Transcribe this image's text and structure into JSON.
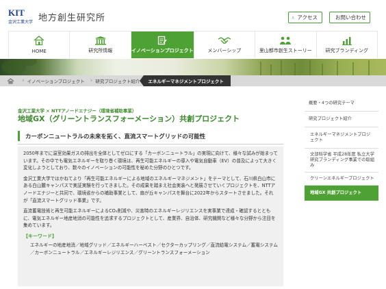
{
  "header": {
    "logo_text": "KIT",
    "logo_sub": "金沢工業大学",
    "site_title": "地方創生研究所",
    "access_label": "アクセス",
    "contact_label": "お問い合わせ"
  },
  "nav": {
    "items": [
      {
        "label": "HOME",
        "icon": "home-icon"
      },
      {
        "label": "研究所情報",
        "icon": "building-icon"
      },
      {
        "label": "イノベーションプロジェクト",
        "icon": "document-icon",
        "active": true
      },
      {
        "label": "メンバーシップ",
        "icon": "handshake-icon"
      },
      {
        "label": "里山都市創生ストーリー",
        "icon": "people-icon"
      },
      {
        "label": "研究ブランディング",
        "icon": "chart-icon"
      }
    ]
  },
  "breadcrumb": {
    "items": [
      "イノベーションプロジェクト",
      "研究プロジェクト紹介"
    ],
    "current": "エネルギーマネジメントプロジェクト"
  },
  "main": {
    "org": "金沢工業大学 × NTTアノードエナジー（環境省補助事業）",
    "title": "地域GX（グリーントランスフォーメーション）共創プロジェクト",
    "section_heading": "カーボンニュートラルの未来を拓く、直流スマートグリッドの可能性",
    "paragraphs": [
      "2050年までに温室効果ガスの排出を全体としてゼロにする「カーボンニュートラル」の実現に向けて、様々な試みが始まっています。その中でも電気エネルギーを取り巻く環境は、再生可能エネルギーの導入や電気自動車（EV）の普及によって大きく変化しようとしており、数々のイノベーションの可能性を秘めた分野のひとつです。",
      "金沢工業大学ではかねてより「再生可能エネルギーによる地域のエネルギーマネジメント」をテーマとして、石川県白山市にある白山麓キャンパスで実証実験を行ってきました。その成果を踏まえ社会実装へと発展させていくプロジェクトを、NTTアノードエナジーと共同で、環境省からの補助事業として、扇が丘キャンパスを舞台に2022年からスタートさせました。それが「直流スマートグリッド事業」です。",
      "直流蓄電技術と再生可能エネルギーによるCO₂削減や、災害時のエネルギーレジリエンスを実事業で達成・確認するとともに、電気エネルギー地産地消の可能性を追求するプロジェクトとして、産業界、自治体、研究機関など様々な分野から注目を集めています。"
    ],
    "keyword_title": "【キーワード】",
    "keywords": "エネルギーの地産地消／地域グリッド／エネルギーハーベスト／セクターカップリング／直流給電システム／蓄電システム／カーボンニュートラル／エネルギーレジリエンス／グリーントランスフォーメーション"
  },
  "sidebar": {
    "items": [
      {
        "label": "概要・4つの研究テーマ"
      },
      {
        "label": "研究プロジェクト紹介"
      },
      {
        "label": "エネルギーマネジメントプロジェクト"
      },
      {
        "label": "文部科学省 平成28年度 私立大学研究ブランディング事業での取組み"
      },
      {
        "label": "クリーンエネルギープロジェクト"
      },
      {
        "label": "地域GX 共創プロジェクト",
        "active": true
      }
    ]
  },
  "colors": {
    "accent_green": "#4ea234",
    "title_green": "#3a8a2c",
    "breadcrumb_bg": "#d9d9d9",
    "body_box_bg": "#f0f0f0"
  }
}
